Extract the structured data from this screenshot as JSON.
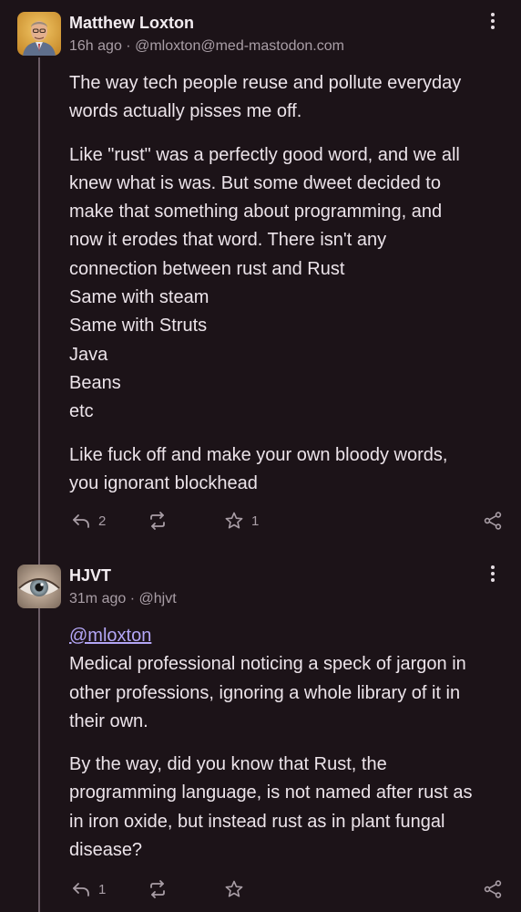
{
  "posts": [
    {
      "author_name": "Matthew Loxton",
      "time": "16h ago",
      "separator": "·",
      "handle": "@mloxton@med-mastodon.com",
      "mention": "",
      "paragraphs": [
        [
          "The way tech people reuse and pollute everyday",
          "words actually pisses me off."
        ],
        [
          "Like \"rust\" was a perfectly good word, and we all",
          "knew what is was. But some dweet decided to",
          "make that something about programming, and",
          "now it erodes that word. There isn't any",
          "connection between rust and Rust",
          "Same with steam",
          "Same with Struts",
          "Java",
          "Beans",
          "etc"
        ],
        [
          "Like fuck off and make your own bloody words,",
          "you ignorant blockhead"
        ]
      ],
      "reply_count": "2",
      "boost_count": "",
      "favourite_count": "1"
    },
    {
      "author_name": "HJVT",
      "time": "31m ago",
      "separator": "·",
      "handle": "@hjvt",
      "mention": "@mloxton",
      "paragraphs": [
        [
          "Medical professional noticing a speck of jargon in",
          "other professions, ignoring a whole library of it in",
          "their own."
        ],
        [
          "By the way, did you know that Rust, the",
          "programming language, is not named after rust as",
          "in iron oxide, but instead rust as in plant fungal",
          "disease?"
        ]
      ],
      "reply_count": "1",
      "boost_count": "",
      "favourite_count": ""
    }
  ],
  "icons": {
    "reply": "reply-icon",
    "boost": "boost-icon",
    "favourite": "star-icon",
    "share": "share-icon",
    "more": "more-vertical-icon"
  },
  "colors": {
    "background": "#1c1318",
    "text": "#ece4ea",
    "secondary_text": "#a99ea6",
    "mention": "#b3a6f5",
    "thread_line": "#6b5c66"
  }
}
